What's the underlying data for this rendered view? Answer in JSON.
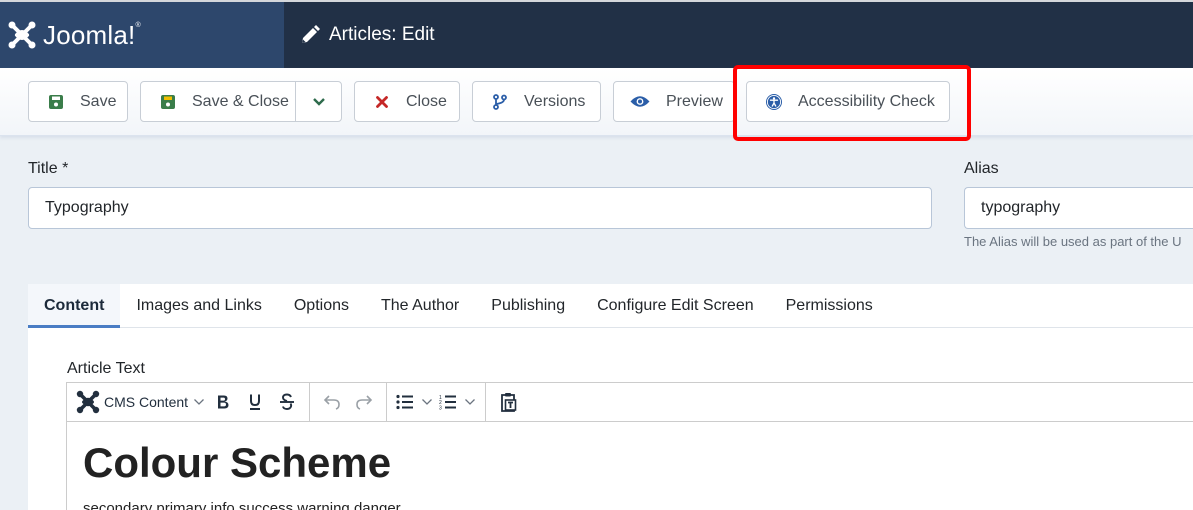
{
  "header": {
    "brand": "Joomla!",
    "brand_mark": "®",
    "title": "Articles: Edit"
  },
  "toolbar": {
    "save": "Save",
    "save_close": "Save & Close",
    "close": "Close",
    "versions": "Versions",
    "preview": "Preview",
    "accessibility_check": "Accessibility Check"
  },
  "colors": {
    "header_bg": "#213046",
    "brand_bg": "#2d476c",
    "save_icon": "#3a7d4a",
    "close_icon": "#c52827",
    "blue_icon": "#2b5ea8",
    "highlight": "#ff0000",
    "active_tab_border": "#4a7dc4"
  },
  "form": {
    "title_label": "Title *",
    "title_value": "Typography",
    "alias_label": "Alias",
    "alias_value": "typography",
    "alias_help": "The Alias will be used as part of the U"
  },
  "tabs": [
    {
      "label": "Content",
      "active": true
    },
    {
      "label": "Images and Links",
      "active": false
    },
    {
      "label": "Options",
      "active": false
    },
    {
      "label": "The Author",
      "active": false
    },
    {
      "label": "Publishing",
      "active": false
    },
    {
      "label": "Configure Edit Screen",
      "active": false
    },
    {
      "label": "Permissions",
      "active": false
    }
  ],
  "editor": {
    "label": "Article Text",
    "format_menu": "CMS Content",
    "heading": "Colour Scheme",
    "paragraph": "secondary primary info success warning danger"
  }
}
